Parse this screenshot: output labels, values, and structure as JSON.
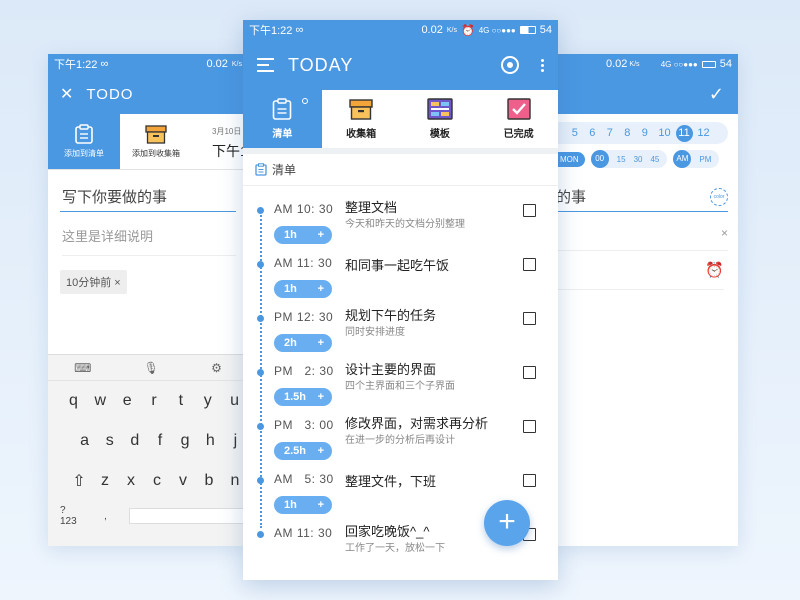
{
  "left": {
    "status": {
      "time": "下午1:22",
      "infinity": "∞",
      "battery_pct": "0.02",
      "unit": "K/s"
    },
    "appbar": {
      "close": "✕",
      "title": "TODO"
    },
    "tabs": [
      {
        "label": "添加到清单"
      },
      {
        "label": "添加到收集箱"
      }
    ],
    "extra": {
      "date": "3月10日",
      "time": "下午1"
    },
    "input_value": "写下你要做的事",
    "desc_placeholder": "这里是详细说明",
    "chip": "10分钟前 ×",
    "keyboard": {
      "row1": [
        "q",
        "w",
        "e",
        "r",
        "t",
        "y",
        "u"
      ],
      "row2": [
        "a",
        "s",
        "d",
        "f",
        "g",
        "h",
        "j"
      ],
      "row3": [
        "z",
        "x",
        "c",
        "v",
        "b",
        "n"
      ],
      "bottom": [
        "?123",
        ","
      ],
      "shift": "⇧"
    }
  },
  "center": {
    "status": {
      "time": "下午1:22",
      "infinity": "∞",
      "net": "0.02",
      "unit": "K/s",
      "signal": "4G ○○●●●",
      "battery": "54"
    },
    "appbar": {
      "title": "TODAY"
    },
    "tabs": [
      {
        "label": "清单"
      },
      {
        "label": "收集箱"
      },
      {
        "label": "模板"
      },
      {
        "label": "已完成"
      }
    ],
    "list_title": "清单",
    "items": [
      {
        "time": "AM 10: 30",
        "title": "整理文档",
        "sub": "今天和昨天的文档分别整理",
        "duration": "1h"
      },
      {
        "time": "AM 11: 30",
        "title": "和同事一起吃午饭",
        "sub": "",
        "duration": "1h"
      },
      {
        "time": "PM 12: 30",
        "title": "规划下午的任务",
        "sub": "同时安排进度",
        "duration": "2h"
      },
      {
        "time": "PM   2: 30",
        "title": "设计主要的界面",
        "sub": "四个主界面和三个子界面",
        "duration": "1.5h"
      },
      {
        "time": "PM   3: 00",
        "title": "修改界面，对需求再分析",
        "sub": "在进一步的分析后再设计",
        "duration": "2.5h"
      },
      {
        "time": "AM   5: 30",
        "title": "整理文件，下班",
        "sub": "",
        "duration": "1h"
      },
      {
        "time": "AM 11: 30",
        "title": "回家吃晚饭^_^",
        "sub": "工作了一天，放松一下",
        "duration": ""
      }
    ],
    "plus": "+",
    "fab": "+"
  },
  "right": {
    "status": {
      "net": "0.02",
      "unit": "K/s",
      "signal": "4G ○○●●●",
      "battery": "54"
    },
    "confirm": "✓",
    "numbers": [
      "5",
      "6",
      "7",
      "8",
      "9",
      "10",
      "11",
      "12"
    ],
    "selected_number": "11",
    "timerow": {
      "day": "MON",
      "minutes": [
        "00",
        "15",
        "30",
        "45"
      ],
      "ampm": [
        "AM",
        "PM"
      ]
    },
    "input_value": "的事",
    "color_label": "color",
    "desc_close": "×",
    "alarm": "⏰"
  },
  "colors": {
    "primary": "#4a97e2",
    "fab": "#5aa4ec",
    "duration": "#68aef0"
  }
}
